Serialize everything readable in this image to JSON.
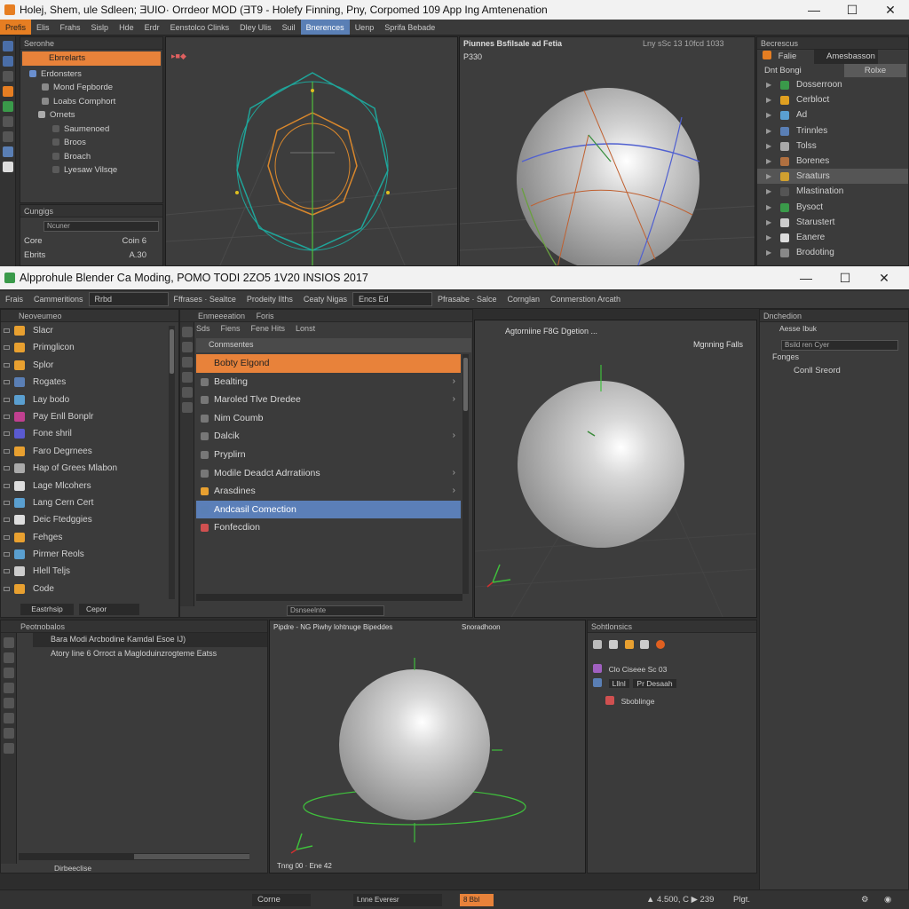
{
  "top_window": {
    "title": "Holej, Shem, ule Sdleen; ƎUIO·  Orrdeor  MOD (ƎT9  -  Holefy Finning, Pny, Corpomed 109 App Ing Amtenenation",
    "controls": {
      "minimize": "—",
      "maximize": "☐",
      "close": "✕"
    },
    "menu": [
      "Prefis",
      "Elis",
      "Frahs",
      "Sislp",
      "Hde",
      "Erdr",
      "Eenstolco Clinks",
      "Dley Ulis",
      "Suil",
      "Bnerences",
      "Uenp",
      "Sprifa Bebade"
    ],
    "outliner": {
      "header": "Seronhe",
      "search": "Ebrrelarts",
      "items": [
        "Erdonsters",
        "Mond Fepborde",
        "Loabs Comphort",
        "Ornets",
        "Saumenoed",
        "Broos",
        "Broach",
        "Lyesaw Vilsqe"
      ]
    },
    "props_panel": {
      "header": "Cungigs",
      "dropdown": "Ncuner",
      "rows": [
        {
          "label": "Core",
          "value": "Coin 6"
        },
        {
          "label": "Ebrits",
          "value": "A.30"
        }
      ]
    },
    "viewport_left": {
      "label": "▸■◆"
    },
    "viewport_right": {
      "title": "Piunnes Bsfilsale ad Fetia",
      "info": "Lny sSc 13 10fcd 1033",
      "sub": "P330"
    },
    "right_panel": {
      "header": "Becrescus",
      "tab1": "Falie",
      "tab2": "Amesbasson",
      "sub_label": "Dnt Bongi",
      "sub_btn": "Rolxe",
      "items": [
        "Dosserroon",
        "Cerbloct",
        "Ad",
        "Trinnles",
        "Tolss",
        "Borenes",
        "Sraaturs",
        "Mlastination",
        "Bysoct",
        "Starustert",
        "Eanere",
        "Brodoting"
      ]
    }
  },
  "main_window": {
    "title": "Alpprohule Blender Ca Moding, POMO TODI 2ZO5 1V20 INSIOS 2017",
    "controls": {
      "minimize": "—",
      "maximize": "☐",
      "close": "✕"
    },
    "toolbar": [
      "Frais",
      "Cammeritions",
      "Rrbd",
      "Fffrases · Sealtce",
      "Prodeity Ilths",
      "Ceaty Nigas",
      "Encs Ed",
      "Pfrasabe · Salce",
      "Cornglan",
      "Conmerstion Arcath"
    ],
    "left_list": {
      "header": "Neoveumeo",
      "items": [
        "Slacr",
        "Primglicon",
        "Splor",
        "Rogates",
        "Lay bodo",
        "Pay Enll Bonplr",
        "Fone shril",
        "Faro Degrnees",
        "Hap of Grees Mlabon",
        "Lage Mlcohers",
        "Lang Cern Cert",
        "Deic Ftedggies",
        "Fehges",
        "Pirmer Reols",
        "Hlell Teljs",
        "Code"
      ],
      "btn1": "Eastrhsip",
      "btn2": "Cepor"
    },
    "menu_panel": {
      "header": "Enmeeeation",
      "header2": "Foris",
      "tabs": [
        "Sds",
        "Fiens",
        "Fene Hits",
        "Lonst"
      ],
      "group": "Conmsentes",
      "items": [
        "Bobty Elgond",
        "Bealting",
        "Maroled Tlve Dredee",
        "Nim Coumb",
        "Dalcik",
        "Pryplirn",
        "Modile Deadct Adrratiions",
        "Arasdines",
        "Andcasil Comection",
        "Fonfecdion"
      ],
      "footer": "Dsnseelnte"
    },
    "viewport_top": {
      "label": "Agtorniine F8G Dgetion ...",
      "label2": "Mgnning Falls"
    },
    "props_right": {
      "header": "Dnchedion",
      "sub": "Aesse Ibuk",
      "field": "Bsild ren Cyer",
      "section": "Fonges",
      "item": "Conll Sreord"
    },
    "timeline": {
      "header": "Peotnobalos",
      "rows": [
        "Bara Modi Arcbodine Kamdal Esoe IJ)",
        "Atory Iine 6 Orroct a Magloduinzrogteme Eatss"
      ],
      "footer": "Dirbeeclise"
    },
    "viewport_bottom": {
      "label": "Pipdre - NG Piwhy lohtnuge Bipeddes",
      "label2": "Snoradhoon",
      "footer": "Tnng 00 · Ene 42"
    },
    "tool_panel": {
      "header": "Sohtlonsics",
      "row1": "Clo Ciseee Sc 03",
      "row2": "Lllnl",
      "row2b": "Pr Desaah",
      "row3": "Sboblinge"
    },
    "status": {
      "left": "Corne",
      "field": "Lnne Everesr",
      "mid": "8 Bbl",
      "right": "▲ 4.500, C ▶ 239",
      "far": "Plgt."
    }
  },
  "colors": {
    "accent_orange": "#e8823a",
    "accent_blue": "#5b7fb8",
    "panel": "#3b3b3b",
    "viewport": "#3d3d3d"
  }
}
